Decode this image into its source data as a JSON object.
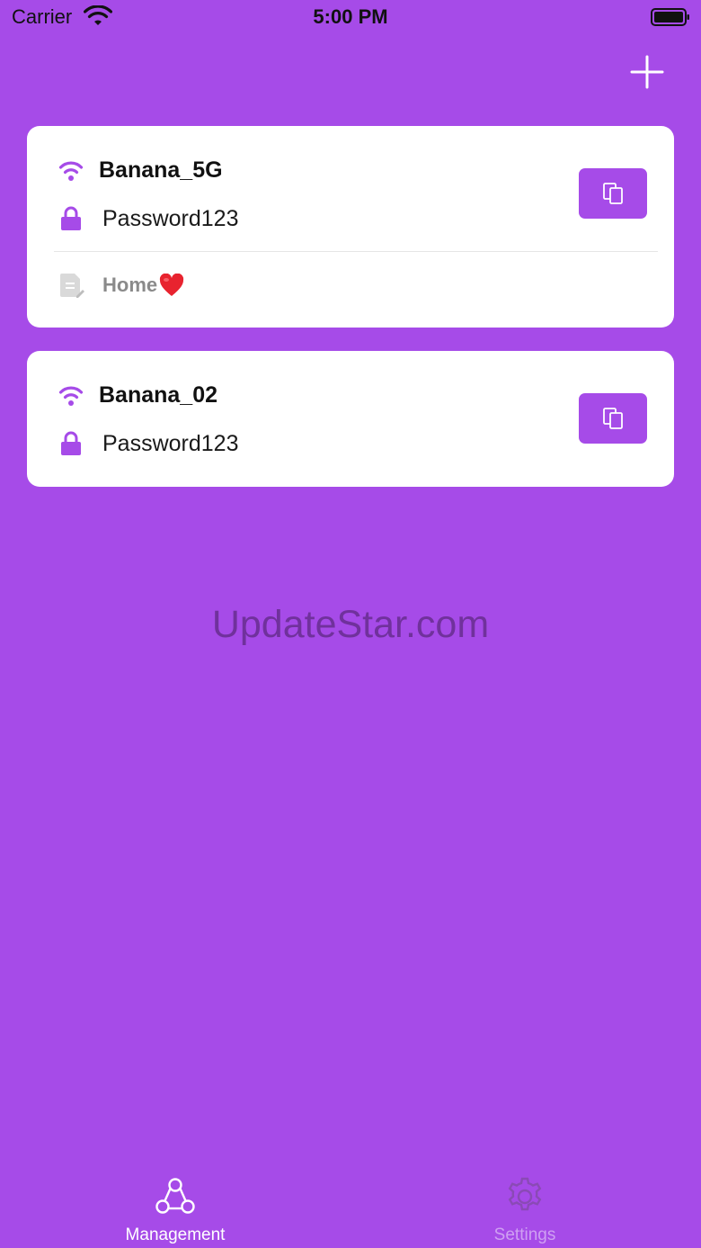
{
  "status_bar": {
    "carrier": "Carrier",
    "time": "5:00 PM"
  },
  "header": {
    "add_icon": "plus-icon"
  },
  "networks": [
    {
      "ssid": "Banana_5G",
      "password": "Password123",
      "note": "Home",
      "note_emoji": "heart-icon"
    },
    {
      "ssid": "Banana_02",
      "password": "Password123"
    }
  ],
  "watermark": "UpdateStar.com",
  "tabs": [
    {
      "label": "Management",
      "icon": "share-nodes-icon",
      "active": true
    },
    {
      "label": "Settings",
      "icon": "gear-icon",
      "active": false
    }
  ],
  "colors": {
    "accent": "#a64be8",
    "card": "#ffffff",
    "note_gray": "#8a8a8a"
  }
}
